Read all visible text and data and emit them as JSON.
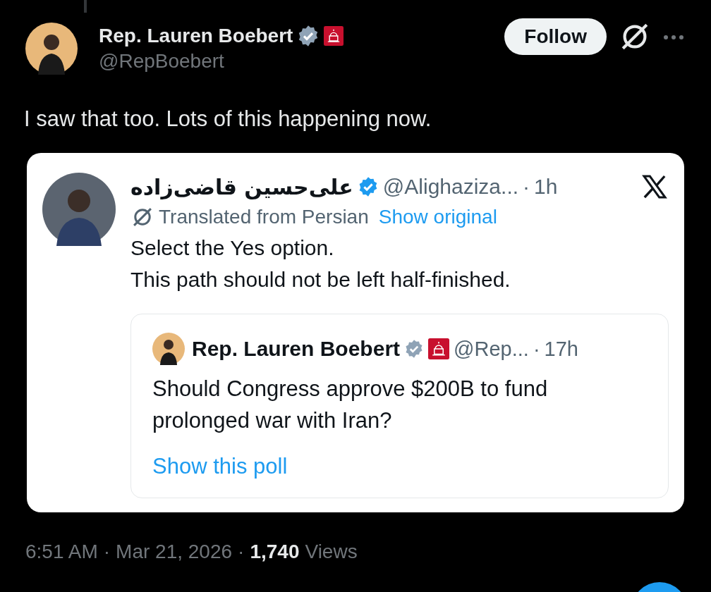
{
  "post": {
    "author": {
      "name": "Rep. Lauren Boebert",
      "handle": "@RepBoebert",
      "verified": true,
      "color": "#8fa3b6",
      "affiliate_badge": true
    },
    "follow_button": "Follow",
    "text": "I saw that too. Lots of this happening now.",
    "quote": {
      "author": {
        "name": "علی‌حسین قاضی‌زاده",
        "handle": "@Alighaziza...",
        "verified": true,
        "color": "#1d9bf0"
      },
      "separator": "·",
      "time": "1h",
      "translation_note": "Translated from Persian",
      "show_original": "Show original",
      "text": [
        "Select the Yes option.",
        "This path should not be left half-finished."
      ],
      "nested_quote": {
        "author": {
          "name": "Rep. Lauren Boebert",
          "handle": "@Rep...",
          "verified": true,
          "color": "#8fa3b6",
          "affiliate_badge": true
        },
        "separator": "·",
        "time": "17h",
        "text": "Should Congress approve $200B to fund prolonged war with Iran?",
        "poll_link": "Show this poll"
      }
    },
    "footer": {
      "time": "6:51 AM",
      "separator_1": "·",
      "date": "Mar 21, 2026",
      "separator_2": "·",
      "views_count": "1,740",
      "views_label": "Views"
    }
  }
}
